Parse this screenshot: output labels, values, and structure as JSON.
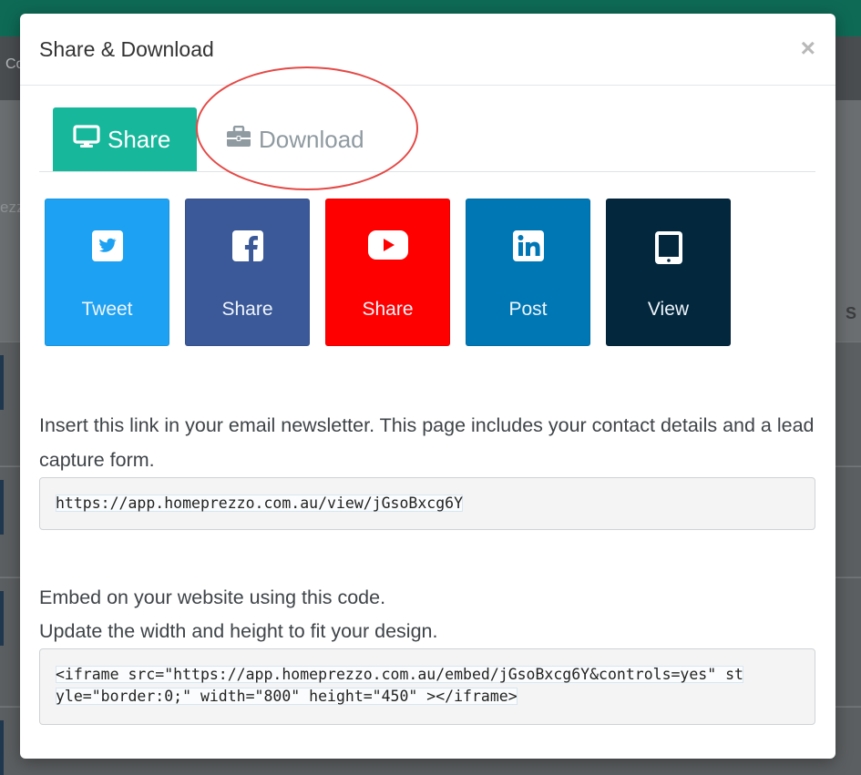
{
  "background": {
    "crumb_fragment": "Co",
    "search_fragment": "ezz",
    "column_fragment": "S"
  },
  "modal": {
    "title": "Share & Download",
    "close_label": "×"
  },
  "tabs": [
    {
      "label": "Share",
      "icon": "monitor-icon",
      "active": true
    },
    {
      "label": "Download",
      "icon": "briefcase-icon",
      "active": false
    }
  ],
  "share_buttons": [
    {
      "label": "Tweet",
      "icon": "twitter-icon",
      "color": "#1da1f2"
    },
    {
      "label": "Share",
      "icon": "facebook-icon",
      "color": "#3b5998"
    },
    {
      "label": "Share",
      "icon": "youtube-icon",
      "color": "#ff0000"
    },
    {
      "label": "Post",
      "icon": "linkedin-icon",
      "color": "#0077b5"
    },
    {
      "label": "View",
      "icon": "tablet-icon",
      "color": "#03273d"
    }
  ],
  "link_section": {
    "description": "Insert this link in your email newsletter. This page includes your contact details and a lead capture form.",
    "url": "https://app.homeprezzo.com.au/view/jGsoBxcg6Y"
  },
  "embed_section": {
    "description_line1": "Embed on your website using this code.",
    "description_line2": "Update the width and height to fit your design.",
    "code_line1": "<iframe src=\"https://app.homeprezzo.com.au/embed/jGsoBxcg6Y&controls=yes\" st",
    "code_line2": "yle=\"border:0;\" width=\"800\" height=\"450\" ></iframe>"
  }
}
